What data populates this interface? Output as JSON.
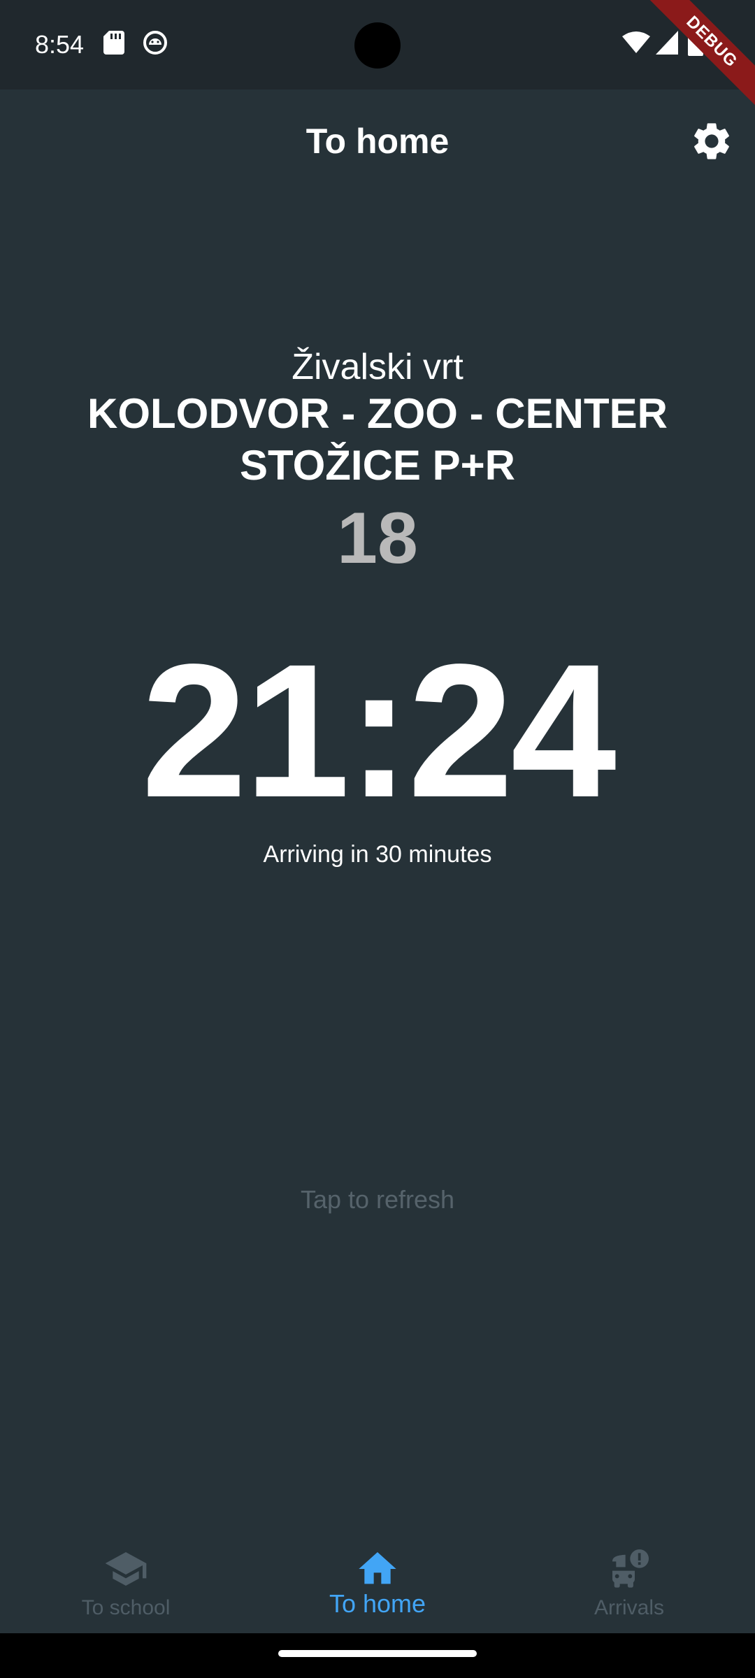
{
  "status_bar": {
    "time": "8:54",
    "left_icons": [
      "sd-card-icon",
      "android-debug-icon"
    ],
    "right_icons": [
      "wifi-icon",
      "signal-icon",
      "battery-icon"
    ]
  },
  "debug_banner": "DEBUG",
  "app_bar": {
    "title": "To home",
    "settings_icon": "gear-icon"
  },
  "departure": {
    "stop_name": "Živalski vrt",
    "route_name": "KOLODVOR - ZOO - CENTER STOŽICE P+R",
    "line_number": "18",
    "time": "21:24",
    "arriving_text": "Arriving in 30 minutes"
  },
  "refresh_hint": "Tap to refresh",
  "bottom_nav": {
    "items": [
      {
        "label": "To school",
        "icon": "graduation-cap-icon",
        "active": false
      },
      {
        "label": "To home",
        "icon": "home-icon",
        "active": true
      },
      {
        "label": "Arrivals",
        "icon": "bus-alert-icon",
        "active": false
      }
    ]
  },
  "colors": {
    "background": "#263238",
    "status_bar": "#20282d",
    "accent": "#42a5f5",
    "inactive": "#4f5d66",
    "line_number": "#b9b9b9",
    "debug_banner": "#8b1a1a"
  }
}
